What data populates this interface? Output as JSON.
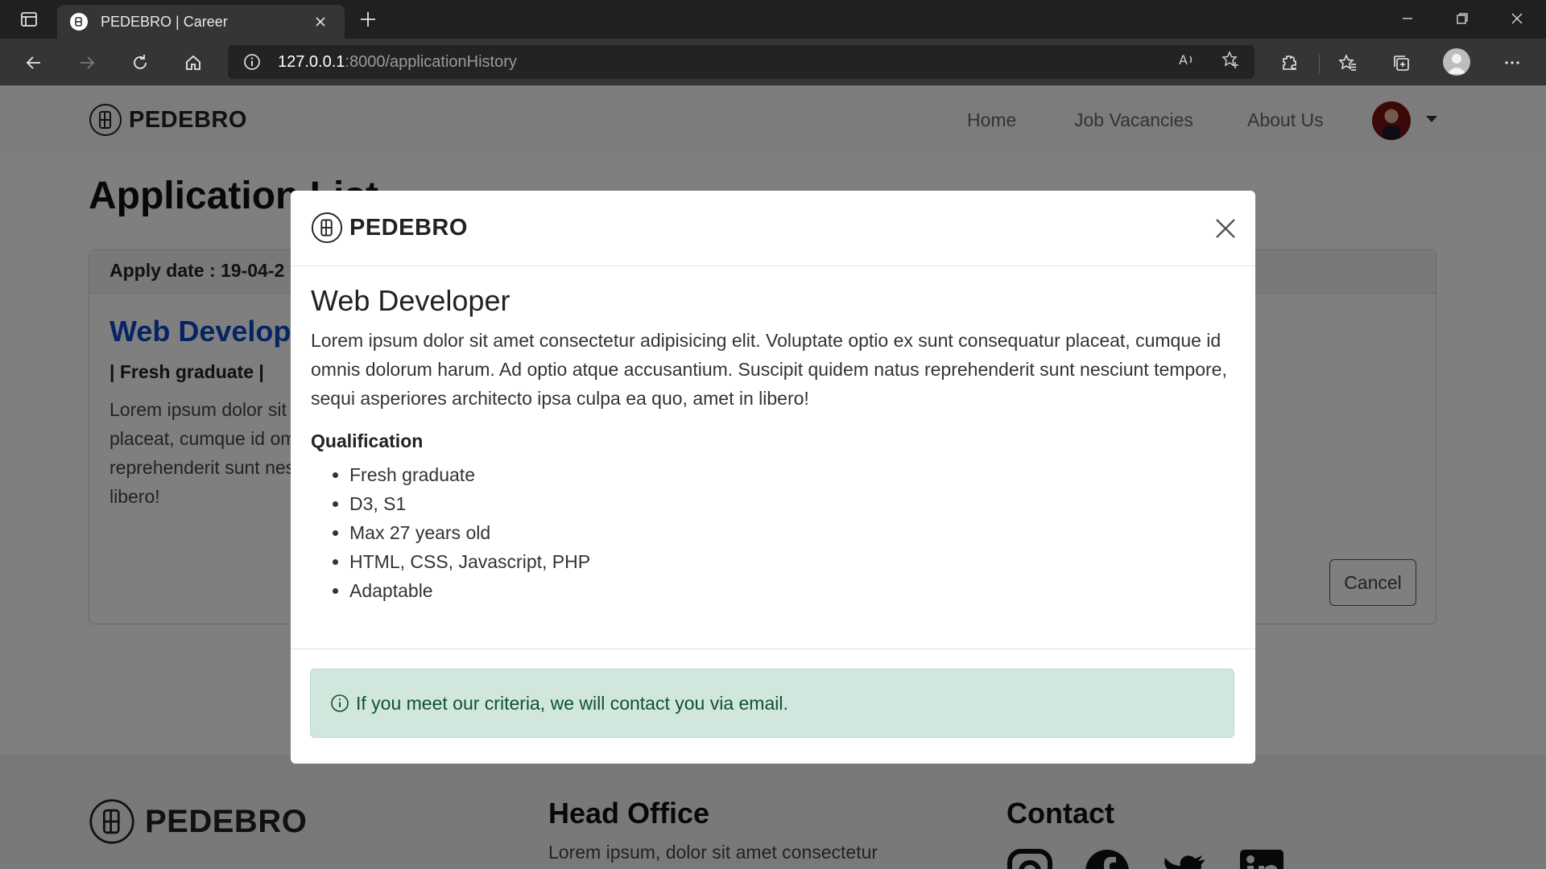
{
  "browser": {
    "tab_title": "PEDEBRO | Career",
    "url_host": "127.0.0.1",
    "url_path": ":8000/applicationHistory"
  },
  "site": {
    "brand": "PEDEBRO",
    "nav": {
      "home": "Home",
      "vacancies": "Job Vacancies",
      "about": "About Us"
    }
  },
  "page": {
    "title": "Application List",
    "card": {
      "apply_date": "Apply date : 19-04-2",
      "job_title": "Web Developer",
      "tag": "| Fresh graduate |",
      "description": "Lorem ipsum dolor sit amet consectetur adipisicing elit. Voluptate optio ex sunt consequatur placeat, cumque id omnis dolorum harum. Ad optio atque accusantium. Suscipit quidem natus reprehenderit sunt nesciunt tempore, sequi asperiores architecto ipsa culpa ea quo, amet in libero!",
      "cancel_label": "Cancel"
    }
  },
  "footer": {
    "brand": "PEDEBRO",
    "head_office_title": "Head Office",
    "head_office_text": "Lorem ipsum, dolor sit amet consectetur",
    "contact_title": "Contact"
  },
  "modal": {
    "brand": "PEDEBRO",
    "job_title": "Web Developer",
    "description": "Lorem ipsum dolor sit amet consectetur adipisicing elit. Voluptate optio ex sunt consequatur placeat, cumque id omnis dolorum harum. Ad optio atque accusantium. Suscipit quidem natus reprehenderit sunt nesciunt tempore, sequi asperiores architecto ipsa culpa ea quo, amet in libero!",
    "qualification_title": "Qualification",
    "qualifications": [
      "Fresh graduate",
      "D3, S1",
      "Max 27 years old",
      "HTML, CSS, Javascript, PHP",
      "Adaptable"
    ],
    "alert_text": "If you meet our criteria, we will contact you via email."
  },
  "colors": {
    "link": "#0d47c9",
    "alert_bg": "#d1e7dd",
    "alert_text": "#0f5132"
  }
}
